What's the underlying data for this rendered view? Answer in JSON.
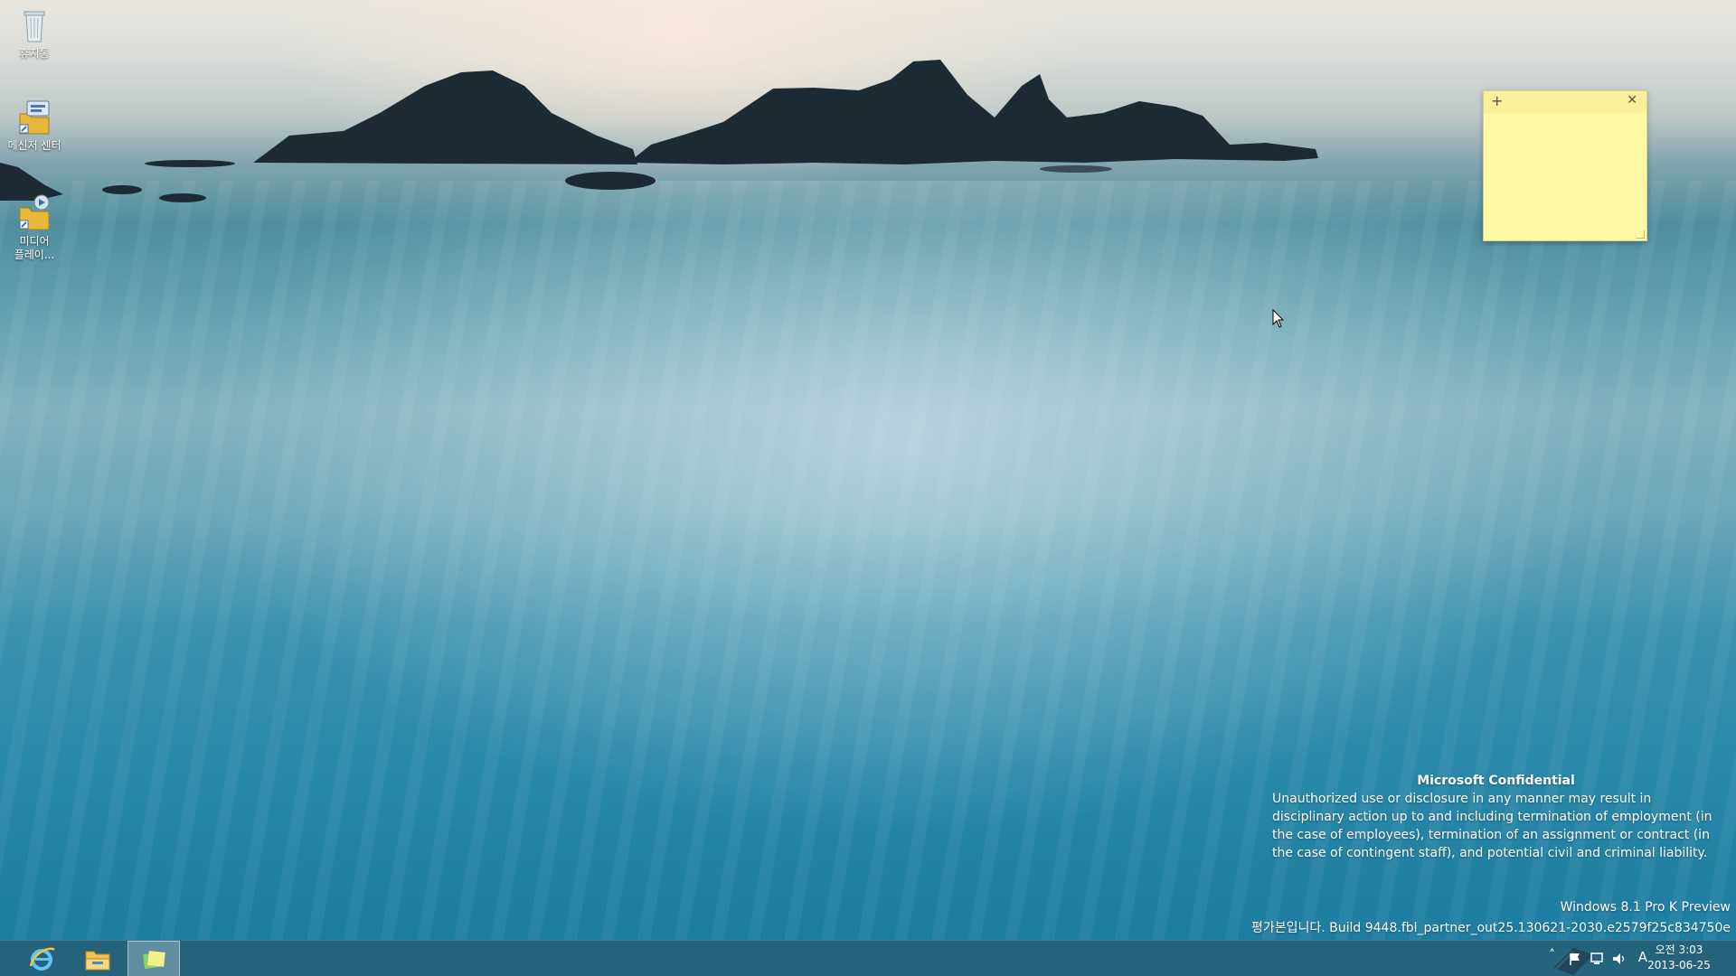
{
  "desktop": {
    "icons": [
      {
        "label": "휴지통",
        "icon": "recycle-bin-icon"
      },
      {
        "label": "메신저 센터",
        "icon": "messenger-center-icon"
      },
      {
        "label": "미디어 플레이...",
        "icon": "media-player-icon"
      }
    ]
  },
  "sticky_note": {
    "add_glyph": "+",
    "close_glyph": "✕",
    "text": "",
    "color": "#fdf8a6"
  },
  "watermark": {
    "title": "Microsoft Confidential",
    "body": "Unauthorized use or disclosure in any manner may result in disciplinary action up to and including termination of employment (in the case of employees), termination of an assignment or contract (in the case of contingent staff), and potential civil and criminal liability.",
    "edition": "Windows 8.1 Pro K Preview",
    "build": "평가본입니다. Build 9448.fbl_partner_out25.130621-2030.e2579f25c834750e"
  },
  "taskbar": {
    "pinned": [
      {
        "name": "internet-explorer",
        "icon": "ie-icon"
      },
      {
        "name": "file-explorer",
        "icon": "folder-icon"
      },
      {
        "name": "sticky-notes",
        "icon": "sticky-notes-icon",
        "active": true
      }
    ],
    "tray": {
      "chevron": "˄",
      "input_indicator": "A",
      "time": "오전 3:03",
      "date": "2013-06-25"
    }
  }
}
